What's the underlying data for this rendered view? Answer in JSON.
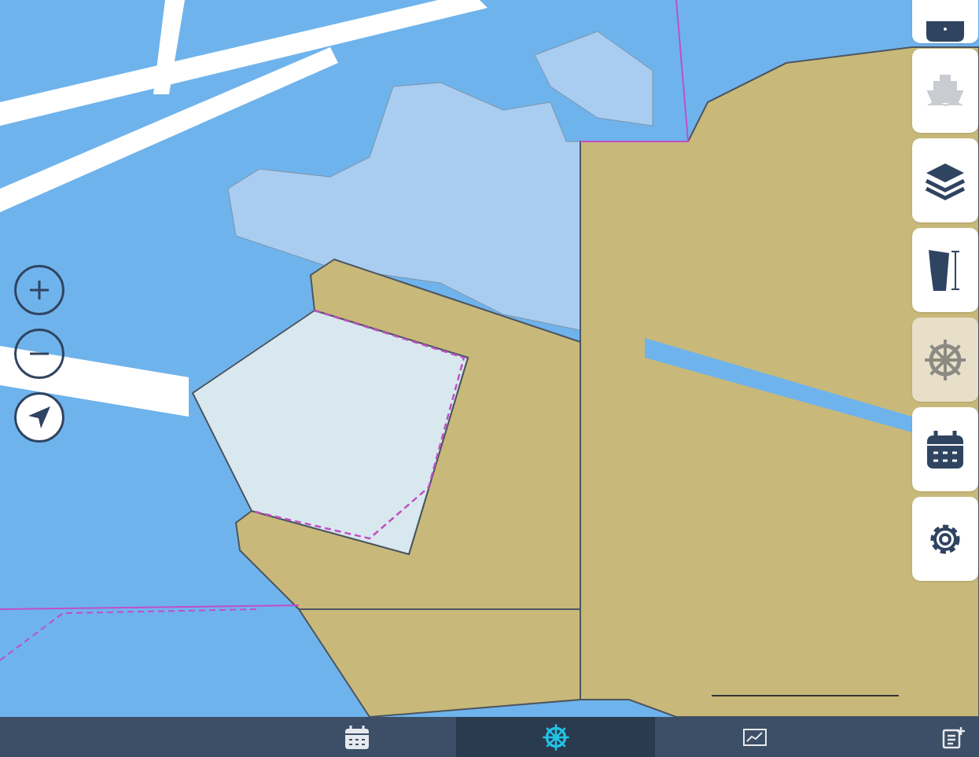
{
  "map_controls": [
    {
      "kind": "zoom_in"
    },
    {
      "kind": "zoom_out"
    },
    {
      "kind": "locate"
    }
  ],
  "side_toolbar": [
    {
      "kind": "alert",
      "selected": false
    },
    {
      "kind": "vessel",
      "selected": false
    },
    {
      "kind": "layers",
      "selected": false
    },
    {
      "kind": "sail",
      "selected": false
    },
    {
      "kind": "helm",
      "selected": true
    },
    {
      "kind": "calendar",
      "selected": false
    },
    {
      "kind": "settings",
      "selected": false
    }
  ],
  "bottom_tabs": [
    {
      "kind": "calendar",
      "selected": false
    },
    {
      "kind": "helm",
      "selected": true
    },
    {
      "kind": "chart",
      "selected": false
    },
    {
      "kind": "note",
      "selected": false
    }
  ]
}
